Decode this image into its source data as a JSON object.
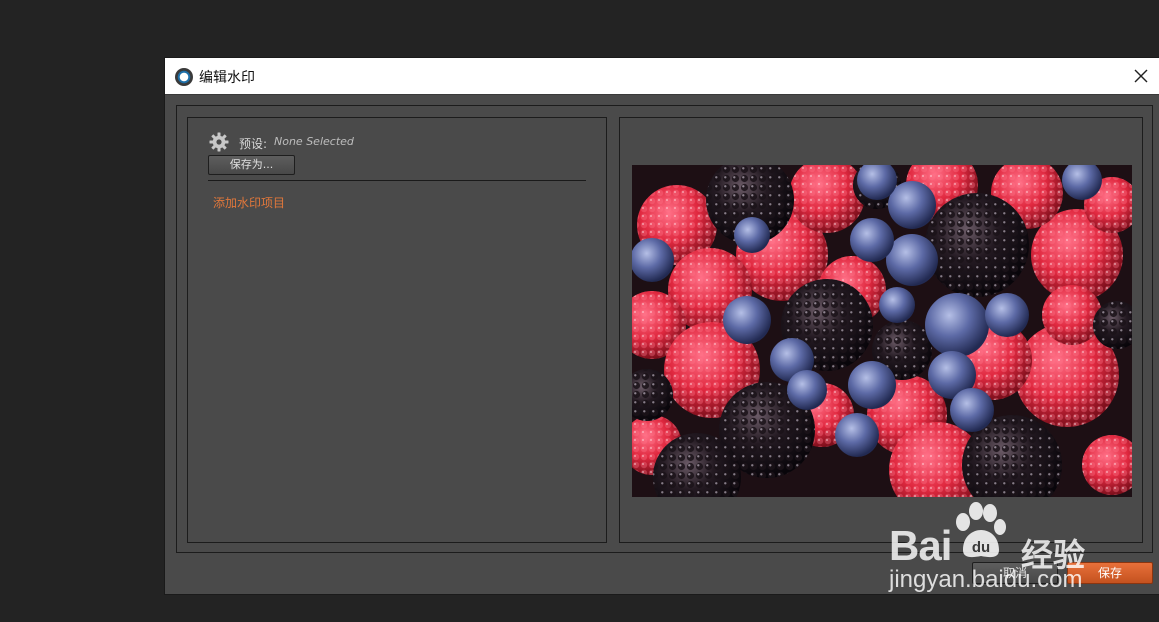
{
  "dialog": {
    "title": "编辑水印",
    "icons": {
      "app": "app-logo-icon",
      "close": "close-icon"
    }
  },
  "left_panel": {
    "preset_label": "预设:",
    "preset_value": "None Selected",
    "save_as_label": "保存为...",
    "add_item_label": "添加水印项目",
    "icons": {
      "preset": "gear-icon"
    }
  },
  "preview": {
    "description_icon": "berries-photo"
  },
  "footer": {
    "cancel_label": "取消",
    "save_label": "保存"
  },
  "watermark": {
    "brand_left": "Bai",
    "brand_right": "经验",
    "url": "jingyan.baidu.com"
  },
  "colors": {
    "accent": "#e0773b",
    "save_button": "#d6602a",
    "panel_bg": "#4a4a4a",
    "background": "#232323"
  }
}
